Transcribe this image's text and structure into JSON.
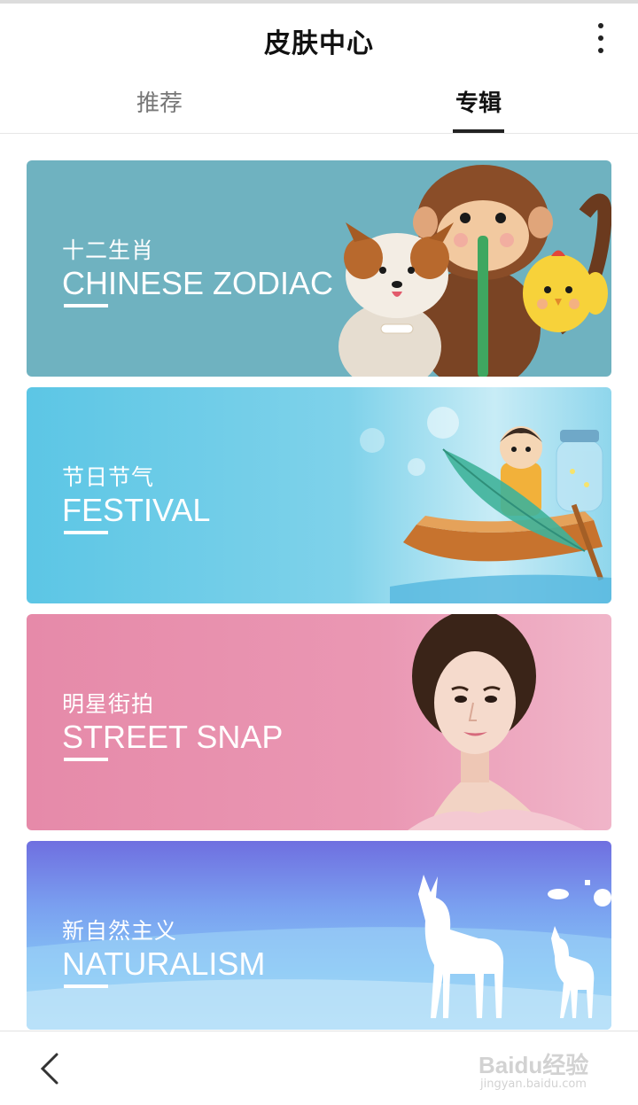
{
  "header": {
    "title": "皮肤中心",
    "more_icon": "more-vertical-icon"
  },
  "tabs": [
    {
      "label": "推荐",
      "active": false
    },
    {
      "label": "专辑",
      "active": true
    }
  ],
  "cards": [
    {
      "title_cn": "十二生肖",
      "title_en": "CHINESE ZODIAC",
      "color": "#6fb2c0"
    },
    {
      "title_cn": "节日节气",
      "title_en": "FESTIVAL",
      "color": "#5cc6e5"
    },
    {
      "title_cn": "明星街拍",
      "title_en": "STREET SNAP",
      "color": "#e68aa9"
    },
    {
      "title_cn": "新自然主义",
      "title_en": "NATURALISM",
      "color": "#7aa0f0"
    }
  ],
  "bottom_bar": {
    "back_icon": "chevron-left-icon"
  },
  "watermark": {
    "main": "Baidu经验",
    "sub": "jingyan.baidu.com"
  }
}
